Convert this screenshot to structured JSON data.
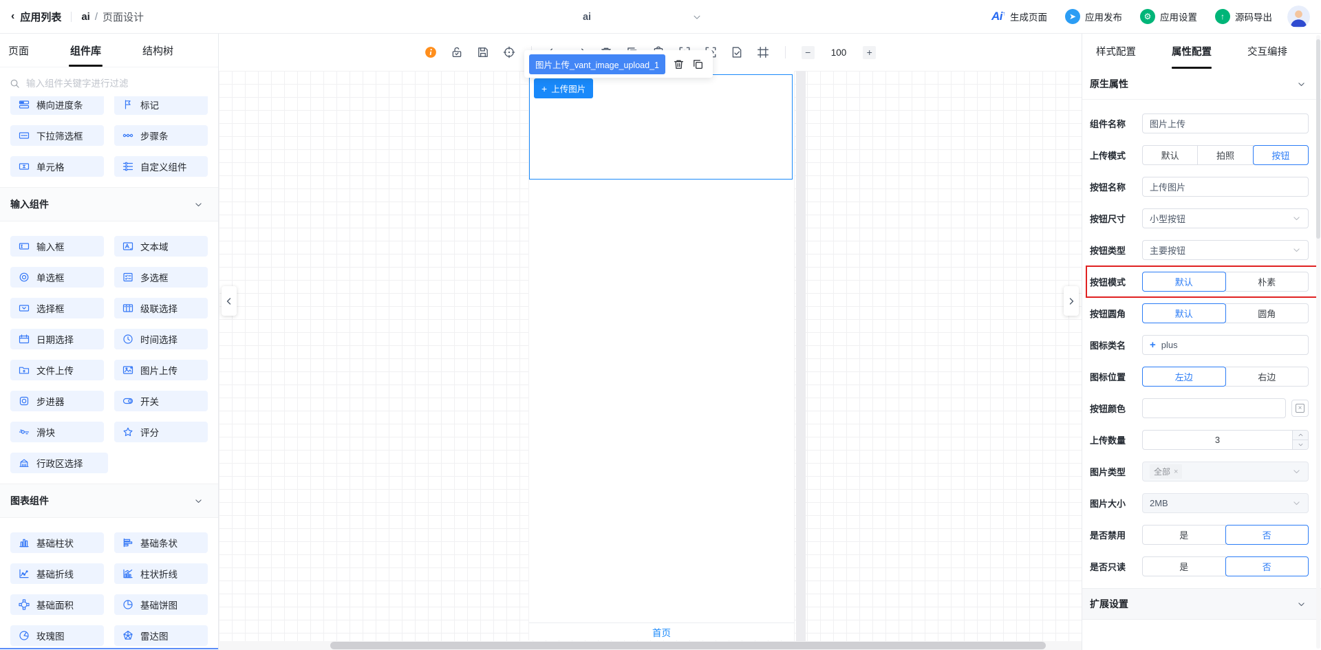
{
  "colors": {
    "accent": "#1989fa",
    "component_icon_blue": "#3477f6",
    "selected_blue": "#2b7cf6",
    "annotation_red": "#e02121",
    "info_orange": "#ff8e1c"
  },
  "topbar": {
    "back": "应用列表",
    "crumb_app": "ai",
    "crumb_divider": "/",
    "crumb_page": "页面设计",
    "page_dropdown": "ai",
    "actions": [
      {
        "name": "generate-page",
        "icon": "ai-logo",
        "logo_text": "Ai",
        "label": "生成页面",
        "icon_bg": ""
      },
      {
        "name": "app-publish",
        "icon": "paper-plane",
        "glyph": "➤",
        "label": "应用发布",
        "icon_bg": "#2b9df4"
      },
      {
        "name": "app-settings",
        "icon": "gear",
        "glyph": "⚙",
        "label": "应用设置",
        "icon_bg": "#00b578"
      },
      {
        "name": "code-export",
        "icon": "export-up",
        "glyph": "↑",
        "label": "源码导出",
        "icon_bg": "#00b578"
      }
    ]
  },
  "left_panel": {
    "tabs": [
      {
        "label": "页面",
        "active": false
      },
      {
        "label": "组件库",
        "active": true
      },
      {
        "label": "结构树",
        "active": false
      }
    ],
    "search_placeholder": "输入组件关键字进行过滤",
    "groups": [
      {
        "type": "items",
        "clipped": true,
        "items": [
          {
            "label": "横向进度条",
            "icon": "progress"
          },
          {
            "label": "标记",
            "icon": "flag"
          }
        ]
      },
      {
        "type": "items",
        "items": [
          {
            "label": "下拉筛选框",
            "icon": "dropdown-box"
          },
          {
            "label": "步骤条",
            "icon": "steps"
          },
          {
            "label": "单元格",
            "icon": "cell"
          },
          {
            "label": "自定义组件",
            "icon": "custom"
          }
        ]
      },
      {
        "type": "section",
        "title": "输入组件"
      },
      {
        "type": "items",
        "items": [
          {
            "label": "输入框",
            "icon": "input"
          },
          {
            "label": "文本域",
            "icon": "textarea"
          },
          {
            "label": "单选框",
            "icon": "radio"
          },
          {
            "label": "多选框",
            "icon": "checkbox"
          },
          {
            "label": "选择框",
            "icon": "select"
          },
          {
            "label": "级联选择",
            "icon": "cascade"
          },
          {
            "label": "日期选择",
            "icon": "calendar"
          },
          {
            "label": "时间选择",
            "icon": "clock"
          },
          {
            "label": "文件上传",
            "icon": "folder-up"
          },
          {
            "label": "图片上传",
            "icon": "image-up"
          },
          {
            "label": "步进器",
            "icon": "stepper"
          },
          {
            "label": "开关",
            "icon": "switch"
          },
          {
            "label": "滑块",
            "icon": "slider"
          },
          {
            "label": "评分",
            "icon": "star"
          },
          {
            "label": "行政区选择",
            "icon": "district"
          }
        ]
      },
      {
        "type": "section",
        "title": "图表组件"
      },
      {
        "type": "items",
        "items": [
          {
            "label": "基础柱状",
            "icon": "bar-chart"
          },
          {
            "label": "基础条状",
            "icon": "bar-h"
          },
          {
            "label": "基础折线",
            "icon": "line-chart"
          },
          {
            "label": "柱状折线",
            "icon": "combo-chart"
          },
          {
            "label": "基础面积",
            "icon": "area-chart"
          },
          {
            "label": "基础饼图",
            "icon": "pie"
          },
          {
            "label": "玫瑰图",
            "icon": "rose"
          },
          {
            "label": "雷达图",
            "icon": "radar"
          }
        ]
      }
    ]
  },
  "toolbar": {
    "left_icons": [
      "info",
      "unlock",
      "save",
      "target"
    ],
    "mid_icons": [
      "undo",
      "redo",
      "trash",
      "duplicate",
      "clipboard"
    ],
    "right_icons": [
      "preview-eye",
      "code",
      "doc-check",
      "frame"
    ],
    "zoom": {
      "minus": "−",
      "value": "100",
      "plus": "+"
    }
  },
  "canvas": {
    "selected_tag": "图片上传_vant_image_upload_1",
    "upload_plus": "+",
    "upload_button": "上传图片",
    "tabbar": "首页"
  },
  "right_panel": {
    "tabs": [
      {
        "label": "样式配置",
        "active": false
      },
      {
        "label": "属性配置",
        "active": true
      },
      {
        "label": "交互编排",
        "active": false
      }
    ],
    "section": "原生属性",
    "fields": [
      {
        "name": "component-name",
        "label": "组件名称",
        "type": "input",
        "value": "图片上传"
      },
      {
        "name": "upload-mode",
        "label": "上传模式",
        "type": "segmented",
        "options": [
          "默认",
          "拍照",
          "按钮"
        ],
        "selected": 2
      },
      {
        "name": "button-name",
        "label": "按钮名称",
        "type": "input",
        "value": "上传图片"
      },
      {
        "name": "button-size",
        "label": "按钮尺寸",
        "type": "select",
        "value": "小型按钮"
      },
      {
        "name": "button-type",
        "label": "按钮类型",
        "type": "select",
        "value": "主要按钮"
      },
      {
        "name": "button-mode",
        "label": "按钮模式",
        "type": "segmented",
        "options": [
          "默认",
          "朴素"
        ],
        "selected": 0,
        "annotated": true
      },
      {
        "name": "button-radius",
        "label": "按钮圆角",
        "type": "segmented",
        "options": [
          "默认",
          "圆角"
        ],
        "selected": 0
      },
      {
        "name": "icon-class",
        "label": "图标类名",
        "type": "icon-input",
        "prefix": "+",
        "value": "plus"
      },
      {
        "name": "icon-position",
        "label": "图标位置",
        "type": "segmented",
        "options": [
          "左边",
          "右边"
        ],
        "selected": 0
      },
      {
        "name": "button-color",
        "label": "按钮颜色",
        "type": "color",
        "value": ""
      },
      {
        "name": "upload-count",
        "label": "上传数量",
        "type": "number",
        "value": "3"
      },
      {
        "name": "image-type",
        "label": "图片类型",
        "type": "tag-select",
        "tag": "全部"
      },
      {
        "name": "image-size",
        "label": "图片大小",
        "type": "select-disabled",
        "value": "2MB"
      },
      {
        "name": "is-disabled",
        "label": "是否禁用",
        "type": "segmented",
        "options": [
          "是",
          "否"
        ],
        "selected": 1
      },
      {
        "name": "is-readonly",
        "label": "是否只读",
        "type": "segmented",
        "options": [
          "是",
          "否"
        ],
        "selected": 1
      }
    ],
    "footer_section": "扩展设置"
  }
}
